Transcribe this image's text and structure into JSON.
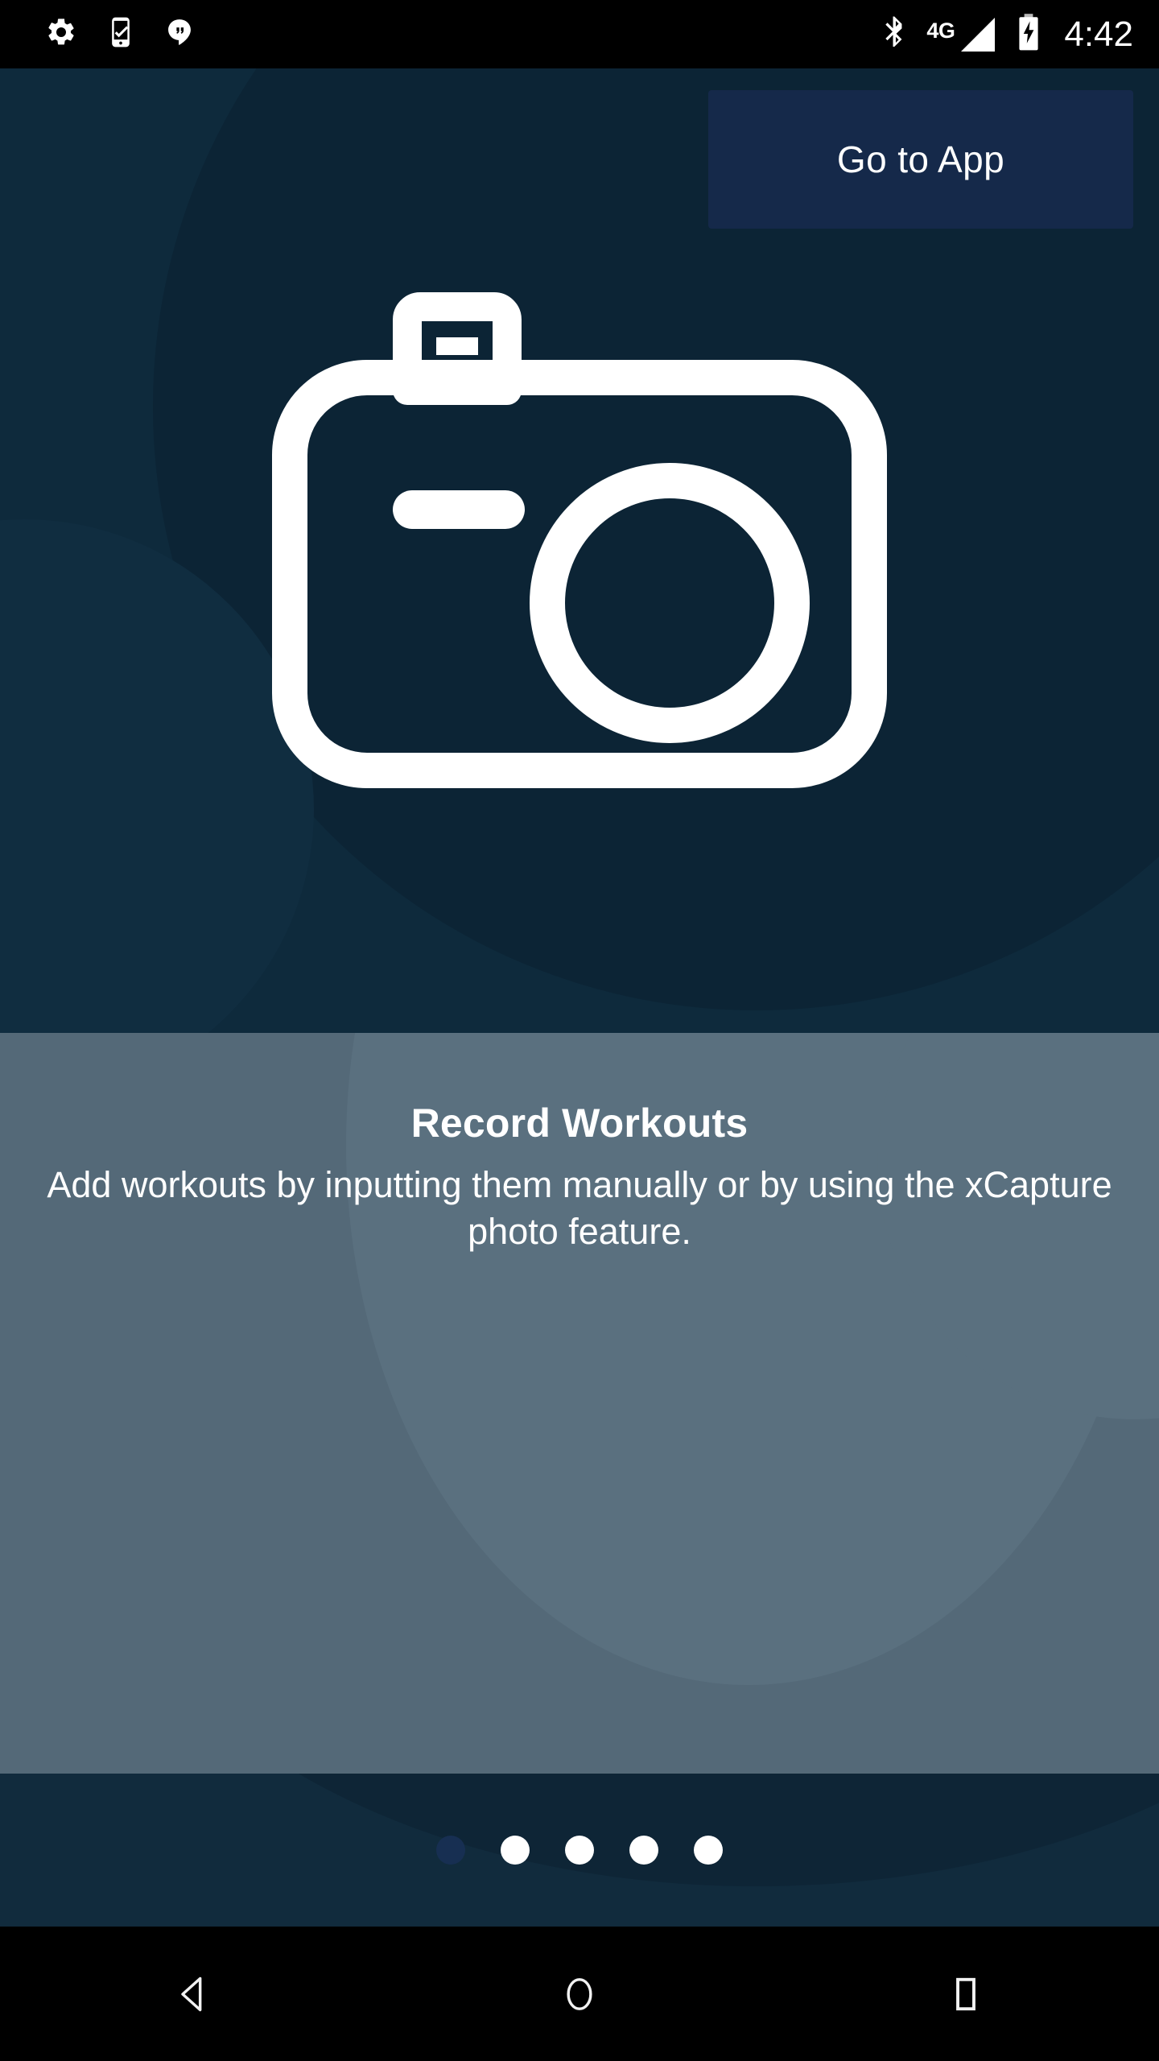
{
  "status_bar": {
    "left_icons": [
      {
        "name": "settings-gear-icon"
      },
      {
        "name": "phone-checkmark-icon"
      },
      {
        "name": "hangouts-icon"
      }
    ],
    "right_icons": [
      {
        "name": "bluetooth-icon"
      },
      {
        "name": "signal-bars-icon"
      },
      {
        "name": "battery-charging-icon"
      }
    ],
    "network_label": "4G",
    "time": "4:42"
  },
  "hero": {
    "go_to_app_label": "Go to App",
    "illustration": "camera-icon",
    "background_color": "#0e2a3c",
    "button_color": "#15294a"
  },
  "panel": {
    "title": "Record Workouts",
    "description": "Add workouts by inputting them manually or by using the xCapture photo feature.",
    "background_color": "#546978"
  },
  "pager": {
    "total_dots": 5,
    "active_index": 0,
    "dots": [
      {
        "active": true
      },
      {
        "active": false
      },
      {
        "active": false
      },
      {
        "active": false
      },
      {
        "active": false
      }
    ]
  },
  "navbar": {
    "buttons": [
      {
        "name": "back-button"
      },
      {
        "name": "home-button"
      },
      {
        "name": "recents-button"
      }
    ]
  }
}
